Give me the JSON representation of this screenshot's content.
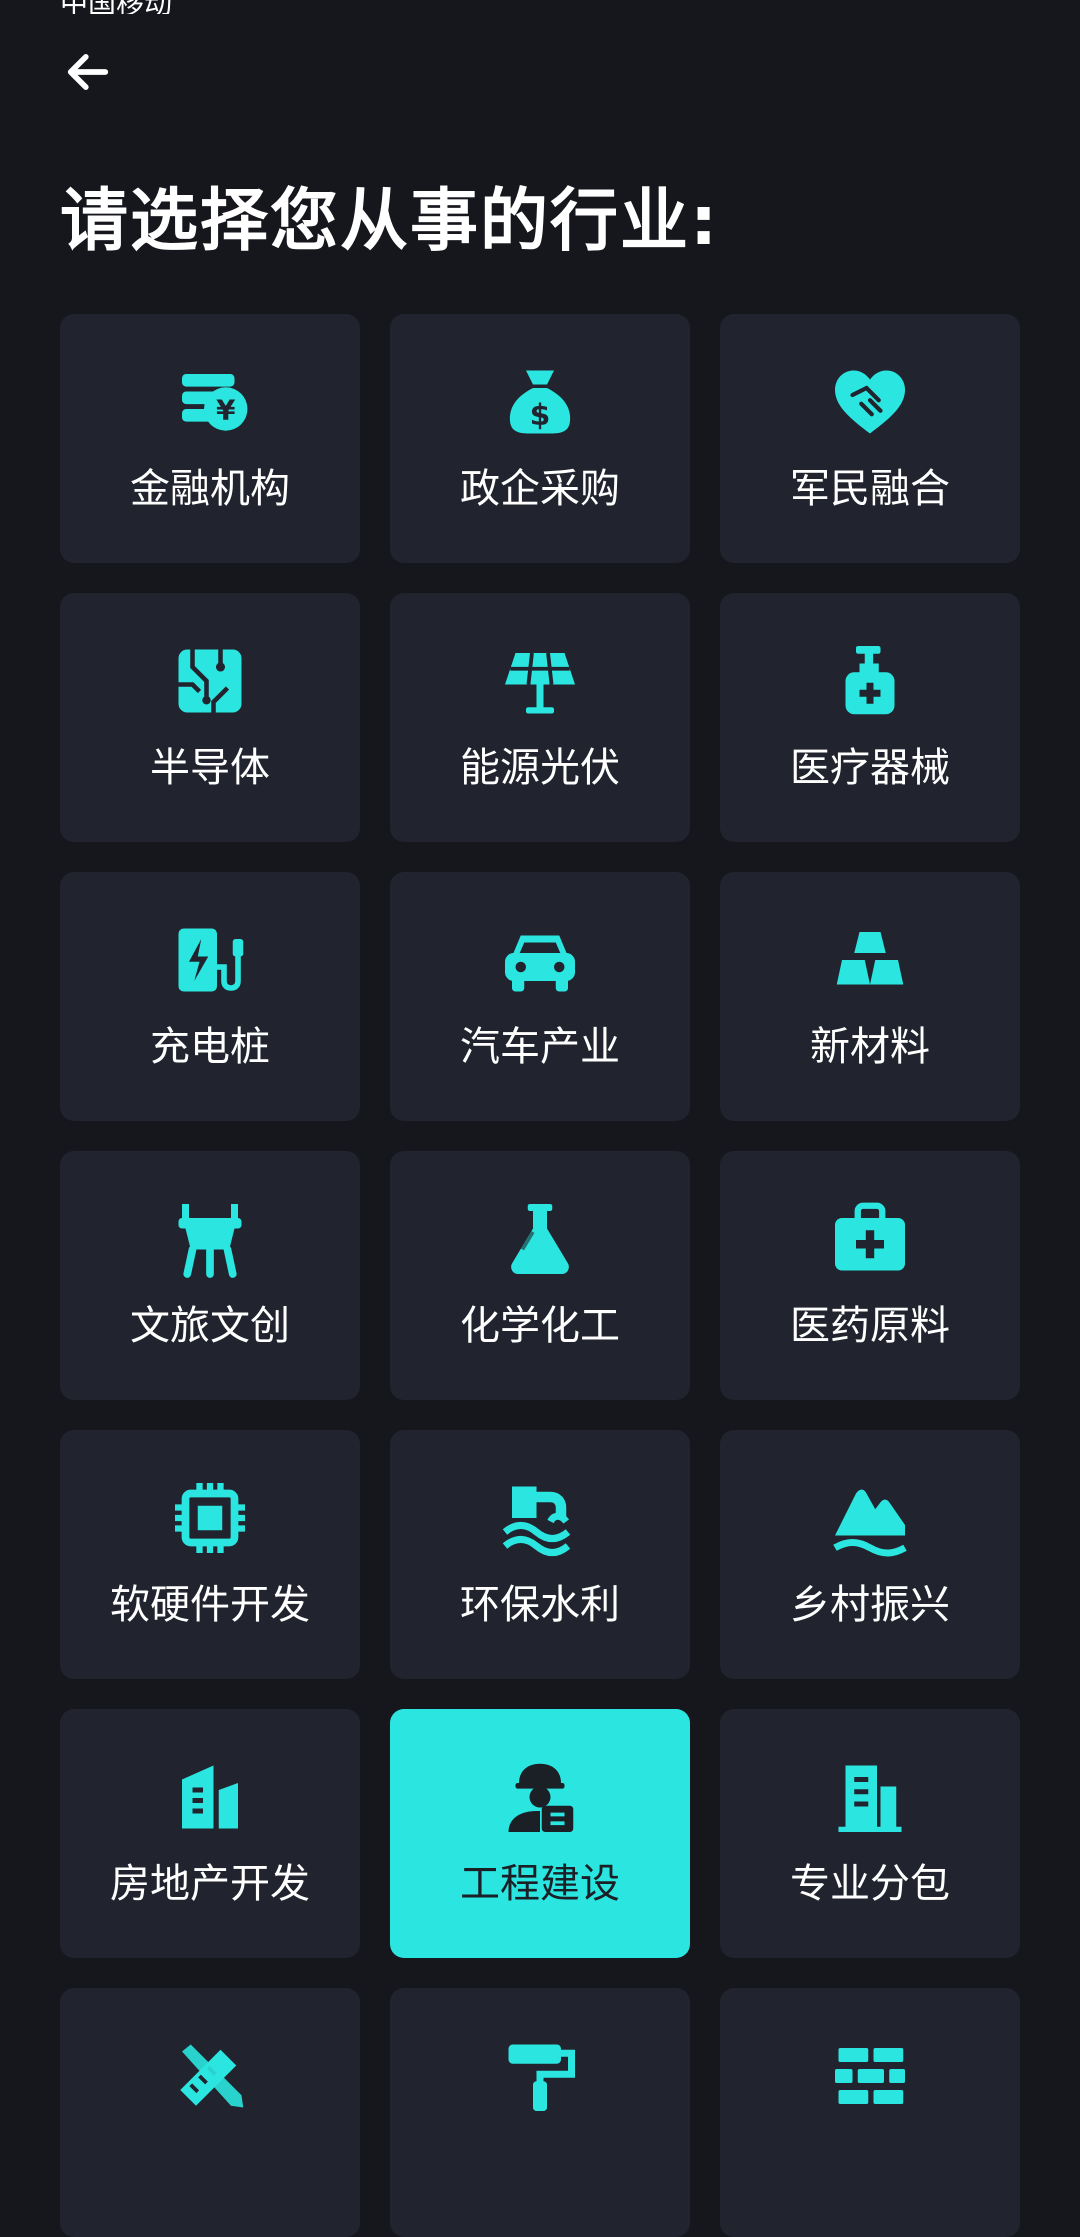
{
  "status_bar": {
    "carrier": "中国移动"
  },
  "header": {
    "back_icon": "arrow-left-icon",
    "title": "请选择您从事的行业:"
  },
  "colors": {
    "accent": "#2be6e0",
    "tile_bg": "#21242e",
    "page_bg": "#15171d",
    "selected_text": "#1b1f26"
  },
  "industries": [
    {
      "label": "金融机构",
      "icon": "coin-stack-icon",
      "selected": false
    },
    {
      "label": "政企采购",
      "icon": "money-bag-icon",
      "selected": false
    },
    {
      "label": "军民融合",
      "icon": "heart-handshake-icon",
      "selected": false
    },
    {
      "label": "半导体",
      "icon": "circuit-board-icon",
      "selected": false
    },
    {
      "label": "能源光伏",
      "icon": "solar-panel-icon",
      "selected": false
    },
    {
      "label": "医疗器械",
      "icon": "sanitizer-bottle-icon",
      "selected": false
    },
    {
      "label": "充电桩",
      "icon": "charging-station-icon",
      "selected": false
    },
    {
      "label": "汽车产业",
      "icon": "car-icon",
      "selected": false
    },
    {
      "label": "新材料",
      "icon": "gold-bars-icon",
      "selected": false
    },
    {
      "label": "文旅文创",
      "icon": "ancient-vessel-icon",
      "selected": false
    },
    {
      "label": "化学化工",
      "icon": "flask-icon",
      "selected": false
    },
    {
      "label": "医药原料",
      "icon": "medical-kit-icon",
      "selected": false
    },
    {
      "label": "软硬件开发",
      "icon": "chip-icon",
      "selected": false
    },
    {
      "label": "环保水利",
      "icon": "water-pipe-icon",
      "selected": false
    },
    {
      "label": "乡村振兴",
      "icon": "mountain-icon",
      "selected": false
    },
    {
      "label": "房地产开发",
      "icon": "buildings-icon",
      "selected": false
    },
    {
      "label": "工程建设",
      "icon": "construction-worker-icon",
      "selected": true
    },
    {
      "label": "专业分包",
      "icon": "office-building-icon",
      "selected": false
    },
    {
      "label": "",
      "icon": "ruler-pencil-icon",
      "selected": false
    },
    {
      "label": "",
      "icon": "paint-roller-icon",
      "selected": false
    },
    {
      "label": "",
      "icon": "brick-wall-icon",
      "selected": false
    }
  ]
}
